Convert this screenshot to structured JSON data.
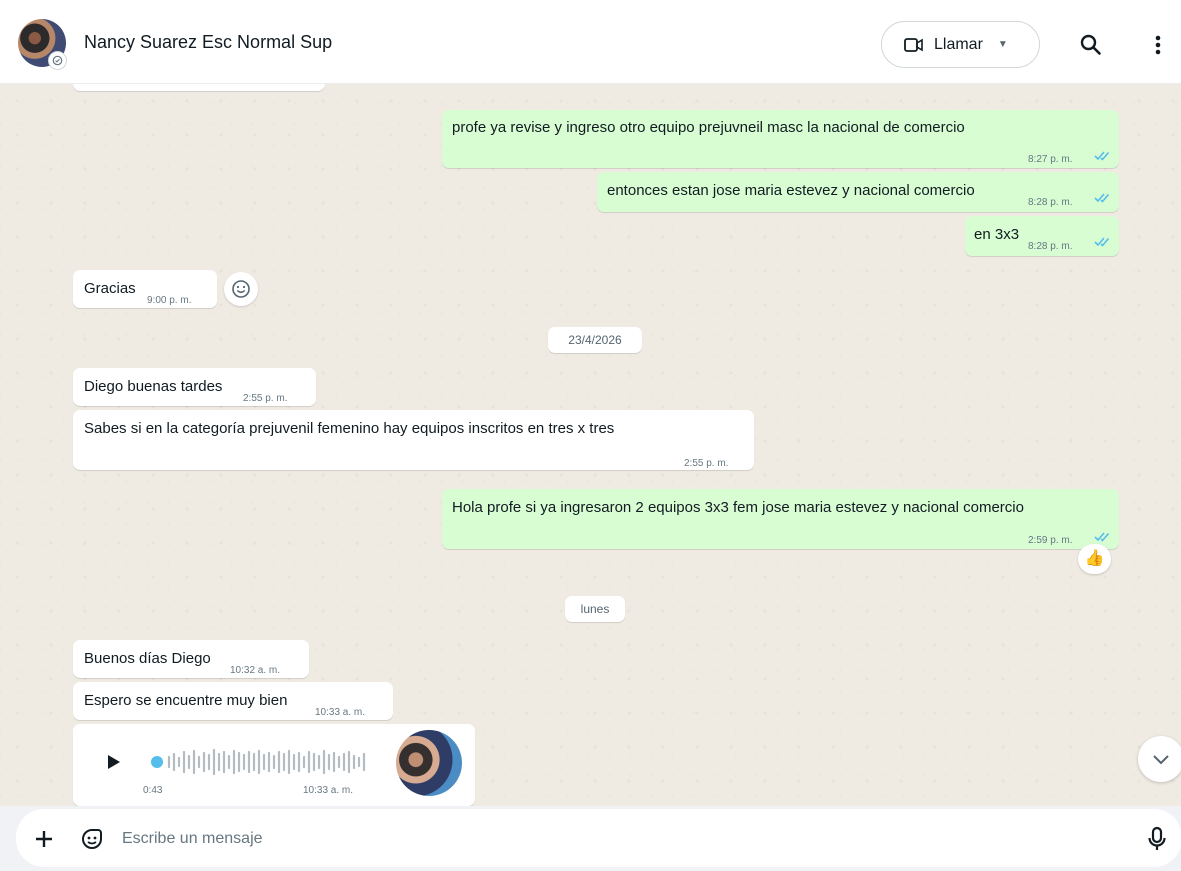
{
  "header": {
    "contact_name": "Nancy Suarez Esc Normal Sup",
    "call_label": "Llamar",
    "icons": [
      "avatar",
      "video-call-icon",
      "chevron-down-icon",
      "search-icon",
      "menu-dots-icon"
    ]
  },
  "messages": {
    "m1": {
      "text": "profe ya revise y ingreso otro equipo prejuvneil masc la nacional de comercio",
      "time": "8:27 p. m."
    },
    "m2": {
      "text": "entonces estan jose maria estevez y nacional comercio",
      "time": "8:28 p. m."
    },
    "m3": {
      "text": "en 3x3",
      "time": "8:28 p. m."
    },
    "m4": {
      "text": "Gracias",
      "time": "9:00 p. m."
    },
    "date1": "23/4/2026",
    "m5": {
      "text": "Diego buenas tardes",
      "time": "2:55 p. m."
    },
    "m6": {
      "text": "Sabes si en la categoría prejuvenil femenino hay equipos inscritos en tres x tres",
      "time": "2:55 p. m."
    },
    "m7": {
      "text": "Hola profe si ya ingresaron 2 equipos 3x3  fem jose maria estevez y nacional comercio",
      "time": "2:59 p. m.",
      "reaction": "👍"
    },
    "date2": "lunes",
    "m8": {
      "text": "Buenos días Diego",
      "time": "10:32 a. m."
    },
    "m9": {
      "text": "Espero se encuentre muy bien",
      "time": "10:33 a. m."
    },
    "audio": {
      "duration": "0:43",
      "time": "10:33 a. m."
    }
  },
  "composer": {
    "placeholder": "Escribe un mensaje"
  },
  "colors": {
    "outgoing_bubble": "#d9fdd3",
    "incoming_bubble": "#ffffff",
    "chat_background": "#efeae2",
    "read_ticks": "#53bdeb"
  }
}
